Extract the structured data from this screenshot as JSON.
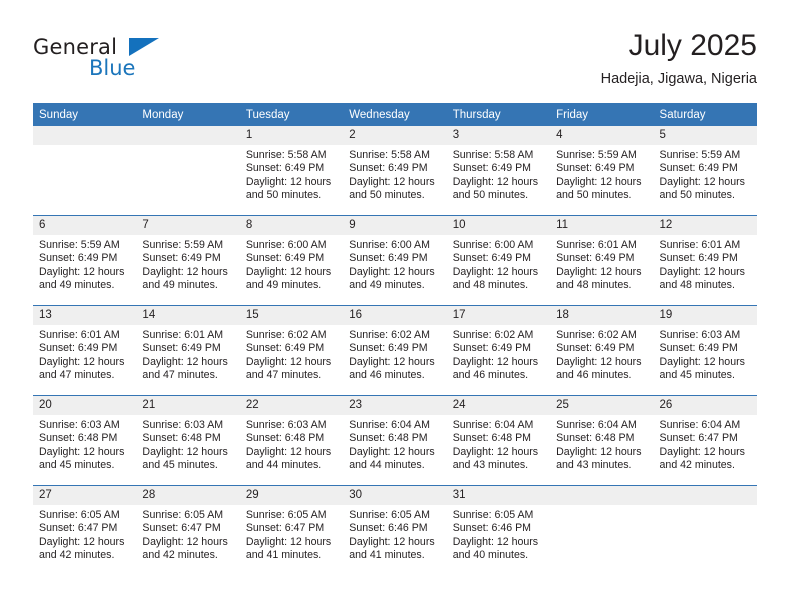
{
  "logo": {
    "word_one": "General",
    "word_two": "Blue",
    "triangle_color": "#1471bd",
    "blue_color": "#1b75bb"
  },
  "header": {
    "title": "July 2025",
    "subtitle": "Hadejia, Jigawa, Nigeria"
  },
  "theme": {
    "header_blue": "#3575b4",
    "daynum_band": "#efefef",
    "text": "#231f20"
  },
  "calendar": {
    "weekday_headers": [
      "Sunday",
      "Monday",
      "Tuesday",
      "Wednesday",
      "Thursday",
      "Friday",
      "Saturday"
    ],
    "weeks": [
      [
        {
          "day": "",
          "sunrise": "",
          "sunset": "",
          "daylight_line1": "",
          "daylight_line2": "",
          "empty": true
        },
        {
          "day": "",
          "sunrise": "",
          "sunset": "",
          "daylight_line1": "",
          "daylight_line2": "",
          "empty": true
        },
        {
          "day": "1",
          "sunrise": "Sunrise: 5:58 AM",
          "sunset": "Sunset: 6:49 PM",
          "daylight_line1": "Daylight: 12 hours",
          "daylight_line2": "and 50 minutes."
        },
        {
          "day": "2",
          "sunrise": "Sunrise: 5:58 AM",
          "sunset": "Sunset: 6:49 PM",
          "daylight_line1": "Daylight: 12 hours",
          "daylight_line2": "and 50 minutes."
        },
        {
          "day": "3",
          "sunrise": "Sunrise: 5:58 AM",
          "sunset": "Sunset: 6:49 PM",
          "daylight_line1": "Daylight: 12 hours",
          "daylight_line2": "and 50 minutes."
        },
        {
          "day": "4",
          "sunrise": "Sunrise: 5:59 AM",
          "sunset": "Sunset: 6:49 PM",
          "daylight_line1": "Daylight: 12 hours",
          "daylight_line2": "and 50 minutes."
        },
        {
          "day": "5",
          "sunrise": "Sunrise: 5:59 AM",
          "sunset": "Sunset: 6:49 PM",
          "daylight_line1": "Daylight: 12 hours",
          "daylight_line2": "and 50 minutes."
        }
      ],
      [
        {
          "day": "6",
          "sunrise": "Sunrise: 5:59 AM",
          "sunset": "Sunset: 6:49 PM",
          "daylight_line1": "Daylight: 12 hours",
          "daylight_line2": "and 49 minutes."
        },
        {
          "day": "7",
          "sunrise": "Sunrise: 5:59 AM",
          "sunset": "Sunset: 6:49 PM",
          "daylight_line1": "Daylight: 12 hours",
          "daylight_line2": "and 49 minutes."
        },
        {
          "day": "8",
          "sunrise": "Sunrise: 6:00 AM",
          "sunset": "Sunset: 6:49 PM",
          "daylight_line1": "Daylight: 12 hours",
          "daylight_line2": "and 49 minutes."
        },
        {
          "day": "9",
          "sunrise": "Sunrise: 6:00 AM",
          "sunset": "Sunset: 6:49 PM",
          "daylight_line1": "Daylight: 12 hours",
          "daylight_line2": "and 49 minutes."
        },
        {
          "day": "10",
          "sunrise": "Sunrise: 6:00 AM",
          "sunset": "Sunset: 6:49 PM",
          "daylight_line1": "Daylight: 12 hours",
          "daylight_line2": "and 48 minutes."
        },
        {
          "day": "11",
          "sunrise": "Sunrise: 6:01 AM",
          "sunset": "Sunset: 6:49 PM",
          "daylight_line1": "Daylight: 12 hours",
          "daylight_line2": "and 48 minutes."
        },
        {
          "day": "12",
          "sunrise": "Sunrise: 6:01 AM",
          "sunset": "Sunset: 6:49 PM",
          "daylight_line1": "Daylight: 12 hours",
          "daylight_line2": "and 48 minutes."
        }
      ],
      [
        {
          "day": "13",
          "sunrise": "Sunrise: 6:01 AM",
          "sunset": "Sunset: 6:49 PM",
          "daylight_line1": "Daylight: 12 hours",
          "daylight_line2": "and 47 minutes."
        },
        {
          "day": "14",
          "sunrise": "Sunrise: 6:01 AM",
          "sunset": "Sunset: 6:49 PM",
          "daylight_line1": "Daylight: 12 hours",
          "daylight_line2": "and 47 minutes."
        },
        {
          "day": "15",
          "sunrise": "Sunrise: 6:02 AM",
          "sunset": "Sunset: 6:49 PM",
          "daylight_line1": "Daylight: 12 hours",
          "daylight_line2": "and 47 minutes."
        },
        {
          "day": "16",
          "sunrise": "Sunrise: 6:02 AM",
          "sunset": "Sunset: 6:49 PM",
          "daylight_line1": "Daylight: 12 hours",
          "daylight_line2": "and 46 minutes."
        },
        {
          "day": "17",
          "sunrise": "Sunrise: 6:02 AM",
          "sunset": "Sunset: 6:49 PM",
          "daylight_line1": "Daylight: 12 hours",
          "daylight_line2": "and 46 minutes."
        },
        {
          "day": "18",
          "sunrise": "Sunrise: 6:02 AM",
          "sunset": "Sunset: 6:49 PM",
          "daylight_line1": "Daylight: 12 hours",
          "daylight_line2": "and 46 minutes."
        },
        {
          "day": "19",
          "sunrise": "Sunrise: 6:03 AM",
          "sunset": "Sunset: 6:49 PM",
          "daylight_line1": "Daylight: 12 hours",
          "daylight_line2": "and 45 minutes."
        }
      ],
      [
        {
          "day": "20",
          "sunrise": "Sunrise: 6:03 AM",
          "sunset": "Sunset: 6:48 PM",
          "daylight_line1": "Daylight: 12 hours",
          "daylight_line2": "and 45 minutes."
        },
        {
          "day": "21",
          "sunrise": "Sunrise: 6:03 AM",
          "sunset": "Sunset: 6:48 PM",
          "daylight_line1": "Daylight: 12 hours",
          "daylight_line2": "and 45 minutes."
        },
        {
          "day": "22",
          "sunrise": "Sunrise: 6:03 AM",
          "sunset": "Sunset: 6:48 PM",
          "daylight_line1": "Daylight: 12 hours",
          "daylight_line2": "and 44 minutes."
        },
        {
          "day": "23",
          "sunrise": "Sunrise: 6:04 AM",
          "sunset": "Sunset: 6:48 PM",
          "daylight_line1": "Daylight: 12 hours",
          "daylight_line2": "and 44 minutes."
        },
        {
          "day": "24",
          "sunrise": "Sunrise: 6:04 AM",
          "sunset": "Sunset: 6:48 PM",
          "daylight_line1": "Daylight: 12 hours",
          "daylight_line2": "and 43 minutes."
        },
        {
          "day": "25",
          "sunrise": "Sunrise: 6:04 AM",
          "sunset": "Sunset: 6:48 PM",
          "daylight_line1": "Daylight: 12 hours",
          "daylight_line2": "and 43 minutes."
        },
        {
          "day": "26",
          "sunrise": "Sunrise: 6:04 AM",
          "sunset": "Sunset: 6:47 PM",
          "daylight_line1": "Daylight: 12 hours",
          "daylight_line2": "and 42 minutes."
        }
      ],
      [
        {
          "day": "27",
          "sunrise": "Sunrise: 6:05 AM",
          "sunset": "Sunset: 6:47 PM",
          "daylight_line1": "Daylight: 12 hours",
          "daylight_line2": "and 42 minutes."
        },
        {
          "day": "28",
          "sunrise": "Sunrise: 6:05 AM",
          "sunset": "Sunset: 6:47 PM",
          "daylight_line1": "Daylight: 12 hours",
          "daylight_line2": "and 42 minutes."
        },
        {
          "day": "29",
          "sunrise": "Sunrise: 6:05 AM",
          "sunset": "Sunset: 6:47 PM",
          "daylight_line1": "Daylight: 12 hours",
          "daylight_line2": "and 41 minutes."
        },
        {
          "day": "30",
          "sunrise": "Sunrise: 6:05 AM",
          "sunset": "Sunset: 6:46 PM",
          "daylight_line1": "Daylight: 12 hours",
          "daylight_line2": "and 41 minutes."
        },
        {
          "day": "31",
          "sunrise": "Sunrise: 6:05 AM",
          "sunset": "Sunset: 6:46 PM",
          "daylight_line1": "Daylight: 12 hours",
          "daylight_line2": "and 40 minutes."
        },
        {
          "day": "",
          "sunrise": "",
          "sunset": "",
          "daylight_line1": "",
          "daylight_line2": "",
          "empty": true
        },
        {
          "day": "",
          "sunrise": "",
          "sunset": "",
          "daylight_line1": "",
          "daylight_line2": "",
          "empty": true
        }
      ]
    ]
  }
}
